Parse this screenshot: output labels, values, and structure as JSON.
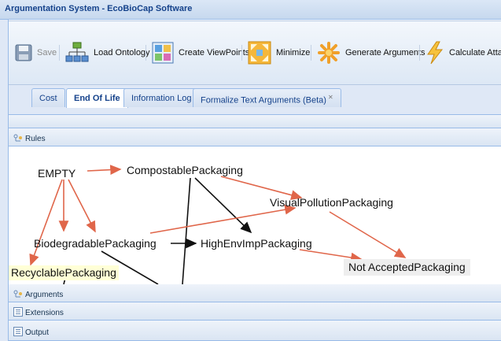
{
  "window": {
    "title": "Argumentation System - EcoBioCap Software"
  },
  "toolbar": {
    "save": "Save",
    "load_ontology": "Load Ontology",
    "create_viewpoints": "Create ViewPoints",
    "minimize": "Minimize",
    "generate_arguments": "Generate Arguments",
    "calculate_attacks": "Calculate Attacks"
  },
  "tabs": [
    {
      "label": "Cost",
      "active": false
    },
    {
      "label": "End Of Life",
      "active": true
    },
    {
      "label": "Information Log",
      "active": false
    },
    {
      "label": "Formalize Text Arguments (Beta)",
      "active": false,
      "closable": true
    }
  ],
  "panels": {
    "rules": "Rules",
    "arguments": "Arguments",
    "extensions": "Extensions",
    "output": "Output"
  },
  "graph": {
    "nodes": {
      "empty": "EMPTY",
      "compostable": "CompostablePackaging",
      "visual_pollution": "VisualPollutionPackaging",
      "biodegradable": "BiodegradablePackaging",
      "high_env_imp": "HighEnvImpPackaging",
      "not_accepted": "Not AcceptedPackaging",
      "recyclable": "RecyclablePackaging"
    }
  },
  "colors": {
    "red_edge": "#e0664a",
    "black_edge": "#111111",
    "header_blue": "#15428b"
  },
  "icons": {
    "save": "floppy-disk-icon",
    "load_ontology": "hierarchy-icon",
    "create_viewpoints": "grid-icon",
    "minimize": "minimize-arrows-icon",
    "generate_arguments": "asterisk-icon",
    "calculate_attacks": "lightning-icon",
    "rules": "tree-icon",
    "arguments": "tree-icon",
    "extensions": "list-icon",
    "output": "list-icon"
  }
}
